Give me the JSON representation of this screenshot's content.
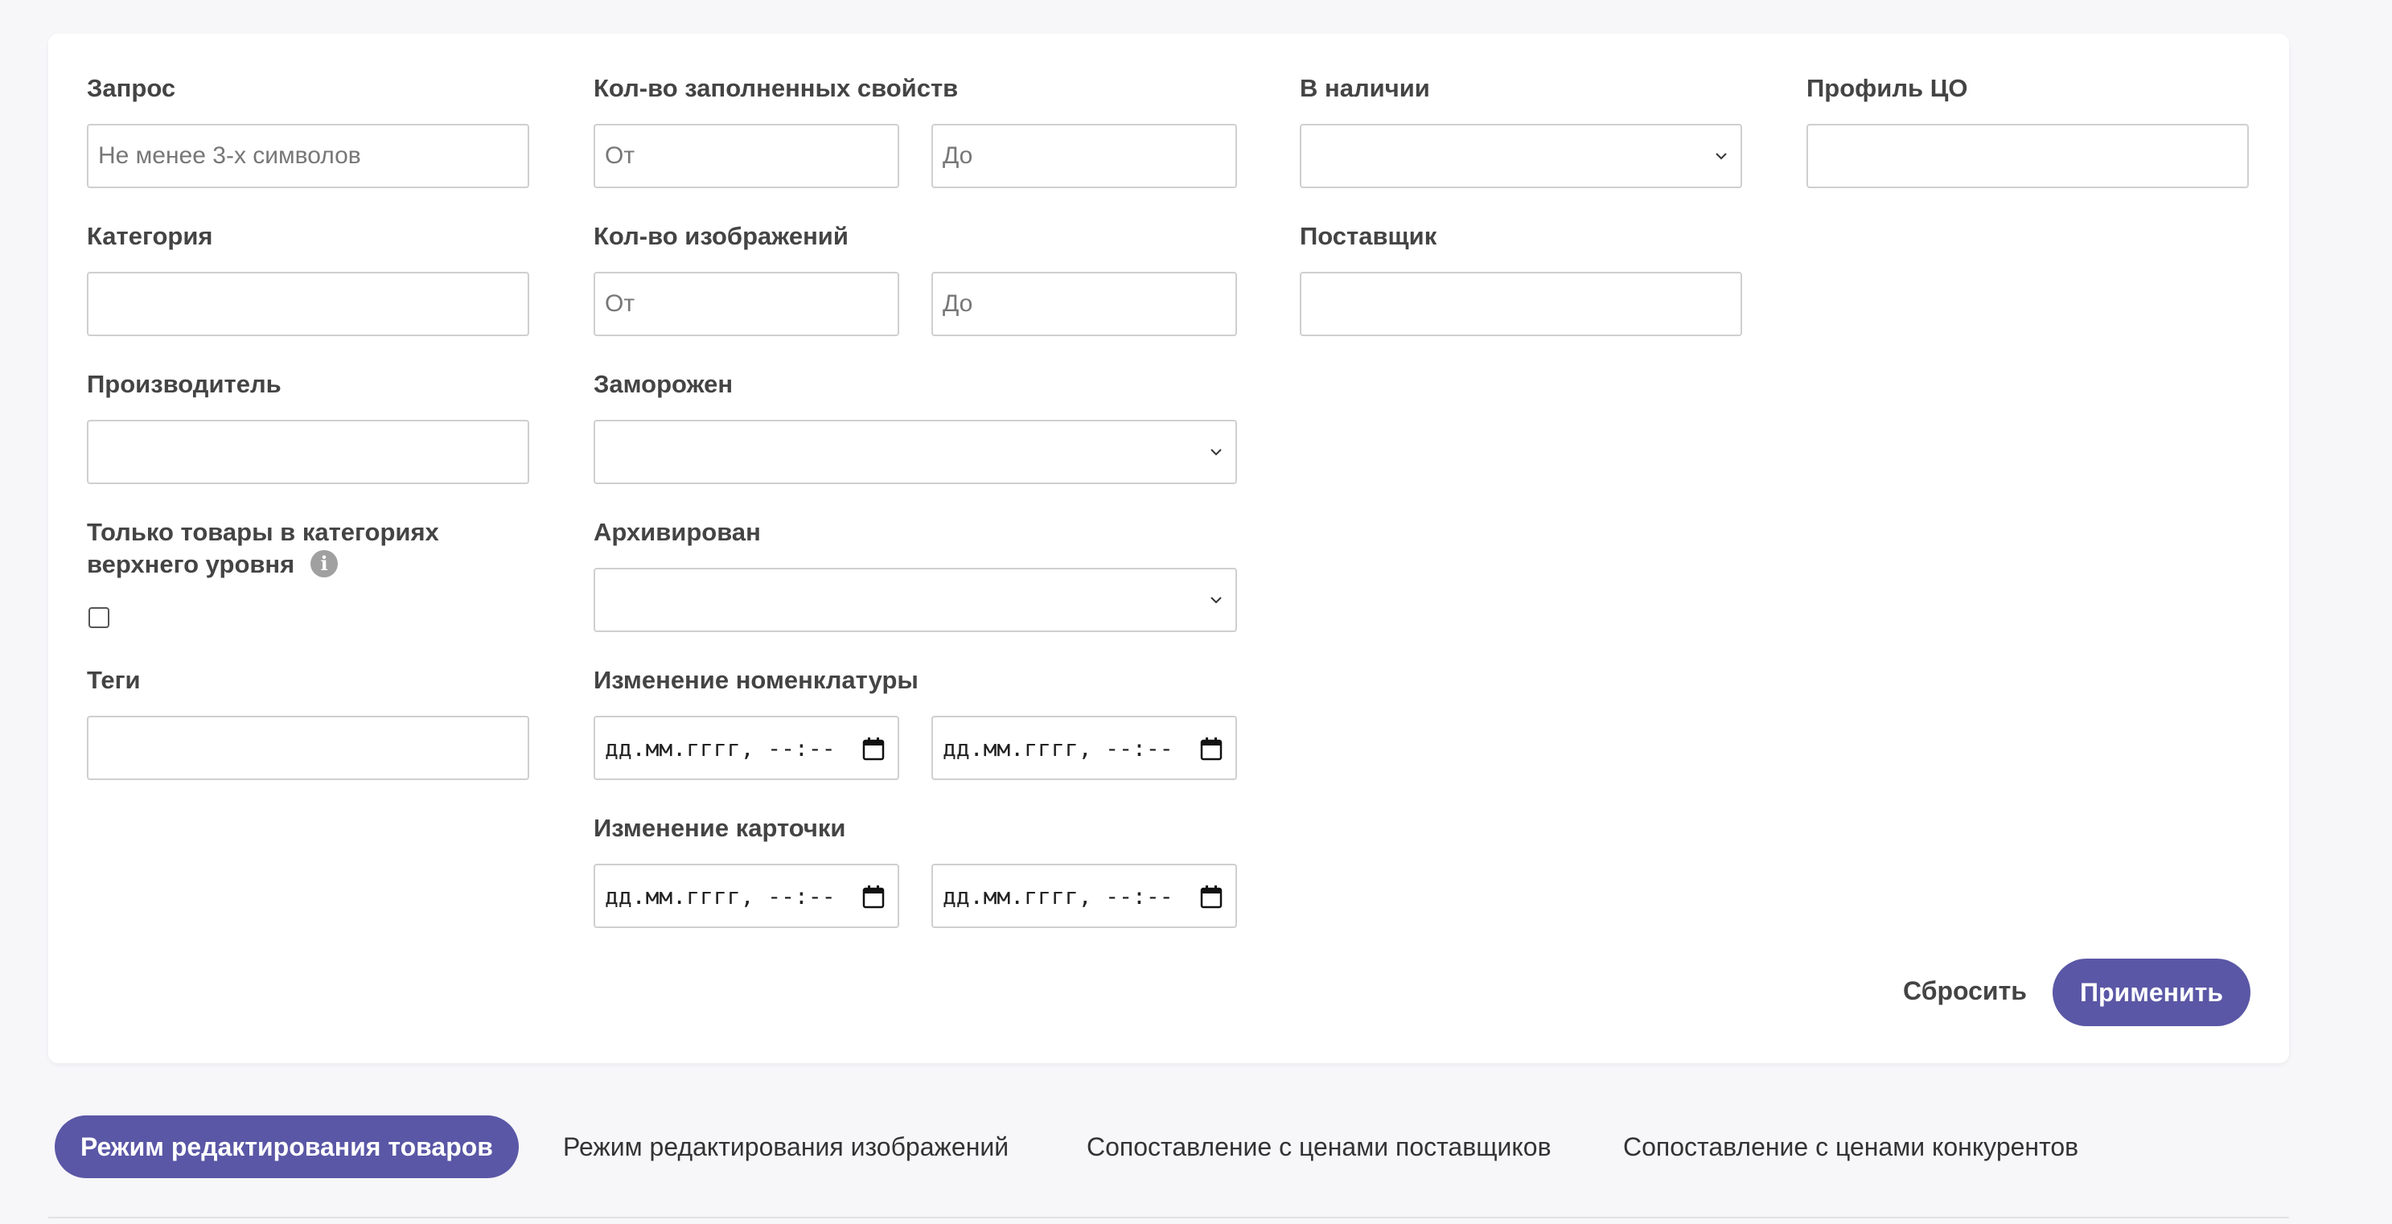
{
  "filters": {
    "query": {
      "label": "Запрос",
      "placeholder": "Не менее 3-х символов"
    },
    "category": {
      "label": "Категория"
    },
    "manufacturer": {
      "label": "Производитель"
    },
    "top_level_only": {
      "label_line1": "Только товары в категориях",
      "label_line2": "верхнего уровня",
      "info_glyph": "i"
    },
    "tags": {
      "label": "Теги"
    },
    "filled_props": {
      "label": "Кол-во заполненных свойств",
      "from_placeholder": "От",
      "to_placeholder": "До"
    },
    "images_count": {
      "label": "Кол-во изображений",
      "from_placeholder": "От",
      "to_placeholder": "До"
    },
    "frozen": {
      "label": "Заморожен"
    },
    "archived": {
      "label": "Архивирован"
    },
    "nomenclature_change": {
      "label": "Изменение номенклатуры",
      "from": "дд.мм.гггг, --:--",
      "to": "дд.мм.гггг, --:--"
    },
    "card_change": {
      "label": "Изменение карточки",
      "from": "дд.мм.гггг, --:--",
      "to": "дд.мм.гггг, --:--"
    },
    "in_stock": {
      "label": "В наличии"
    },
    "supplier": {
      "label": "Поставщик"
    },
    "co_profile": {
      "label": "Профиль ЦО"
    }
  },
  "actions": {
    "reset": "Сбросить",
    "apply": "Применить"
  },
  "tabs": [
    {
      "label": "Режим редактирования товаров",
      "active": true
    },
    {
      "label": "Режим редактирования изображений",
      "active": false
    },
    {
      "label": "Сопоставление с ценами поставщиков",
      "active": false
    },
    {
      "label": "Сопоставление с ценами конкурентов",
      "active": false
    }
  ],
  "colors": {
    "accent": "#5a57a6",
    "background": "#f7f6f9",
    "card": "#ffffff",
    "border": "#cfcfcf"
  }
}
